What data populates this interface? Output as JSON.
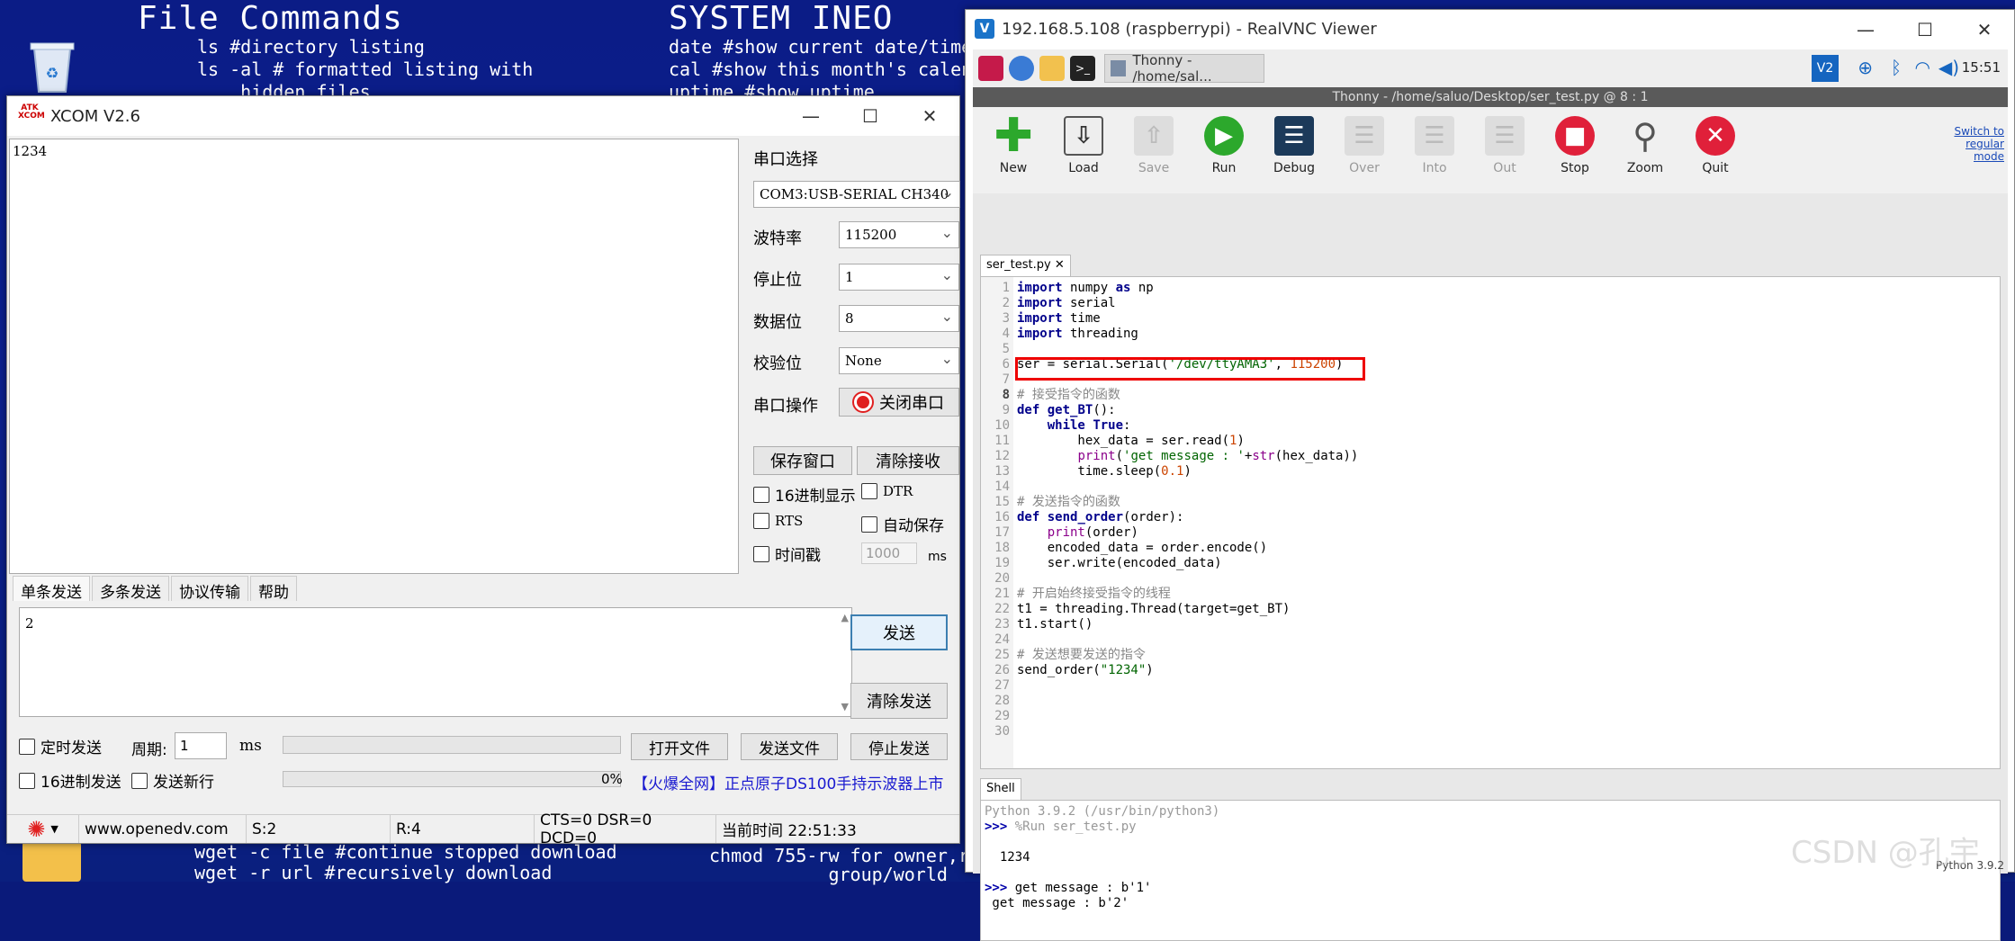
{
  "desktop": {
    "heading_file": "File Commands",
    "heading_sys": "SYSTEM INEO",
    "file_lines": [
      "ls #directory listing",
      "ls -al # formatted listing with",
      "    hidden files"
    ],
    "sys_lines": [
      "date #show current date/time",
      "cal #show this month's calen",
      "uptime #show uptime"
    ],
    "bottom_left": [
      "wget -c file #continue stopped download",
      "wget -r url #recursively download"
    ],
    "bottom_right": [
      "chmod 755-rw for owner,r",
      "           group/world"
    ],
    "watermark": "CSDN @孔宇"
  },
  "xcom": {
    "title": "XCOM V2.6",
    "logo": "ATK XCOM",
    "received": "1234",
    "port_label": "串口选择",
    "port_value": "COM3:USB-SERIAL CH340",
    "baud_label": "波特率",
    "baud_value": "115200",
    "stop_label": "停止位",
    "stop_value": "1",
    "data_label": "数据位",
    "data_value": "8",
    "parity_label": "校验位",
    "parity_value": "None",
    "op_label": "串口操作",
    "close_port": "关闭串口",
    "save_window": "保存窗口",
    "clear_recv": "清除接收",
    "hex_display": "16进制显示",
    "dtr": "DTR",
    "rts": "RTS",
    "auto_save": "自动保存",
    "timestamp": "时间戳",
    "timestamp_value": "1000",
    "ms": "ms",
    "tabs": [
      "单条发送",
      "多条发送",
      "协议传输",
      "帮助"
    ],
    "send_text": "2",
    "send_btn": "发送",
    "clear_send": "清除发送",
    "timed_send": "定时发送",
    "period_label": "周期:",
    "period_value": "1",
    "period_unit": "ms",
    "open_file": "打开文件",
    "send_file": "发送文件",
    "stop_send": "停止发送",
    "hex_send": "16进制发送",
    "send_newline": "发送新行",
    "percent": "0%",
    "ad": "【火爆全网】正点原子DS100手持示波器上市",
    "status_url": "www.openedv.com",
    "status_s": "S:2",
    "status_r": "R:4",
    "status_lines": "CTS=0 DSR=0 DCD=0",
    "status_time": "当前时间 22:51:33"
  },
  "vnc": {
    "title": "192.168.5.108 (raspberrypi) - RealVNC Viewer",
    "taskbar_thonny": "Thonny  -  /home/sal...",
    "clock": "15:51",
    "thonny_title": "Thonny  -  /home/saluo/Desktop/ser_test.py  @  8 : 1",
    "tools": [
      "New",
      "Load",
      "Save",
      "Run",
      "Debug",
      "Over",
      "Into",
      "Out",
      "Stop",
      "Zoom",
      "Quit"
    ],
    "switch_mode": "Switch to regular mode",
    "file_tab": "ser_test.py",
    "shell_tab": "Shell",
    "python_version": "Python 3.9.2"
  },
  "shell": {
    "banner": "Python 3.9.2 (/usr/bin/python3)",
    "run_prompt": ">>> ",
    "run_cmd": "%Run ser_test.py",
    "output1": "  1234",
    "msg1_prompt": ">>> ",
    "msg1": "get message : b'1'",
    "msg2": " get message : b'2'"
  },
  "colors": {
    "wallpaper": "#0b1c86",
    "highlight": "#e00000",
    "run_green": "#2ca82c",
    "stop_red": "#e0203a"
  }
}
